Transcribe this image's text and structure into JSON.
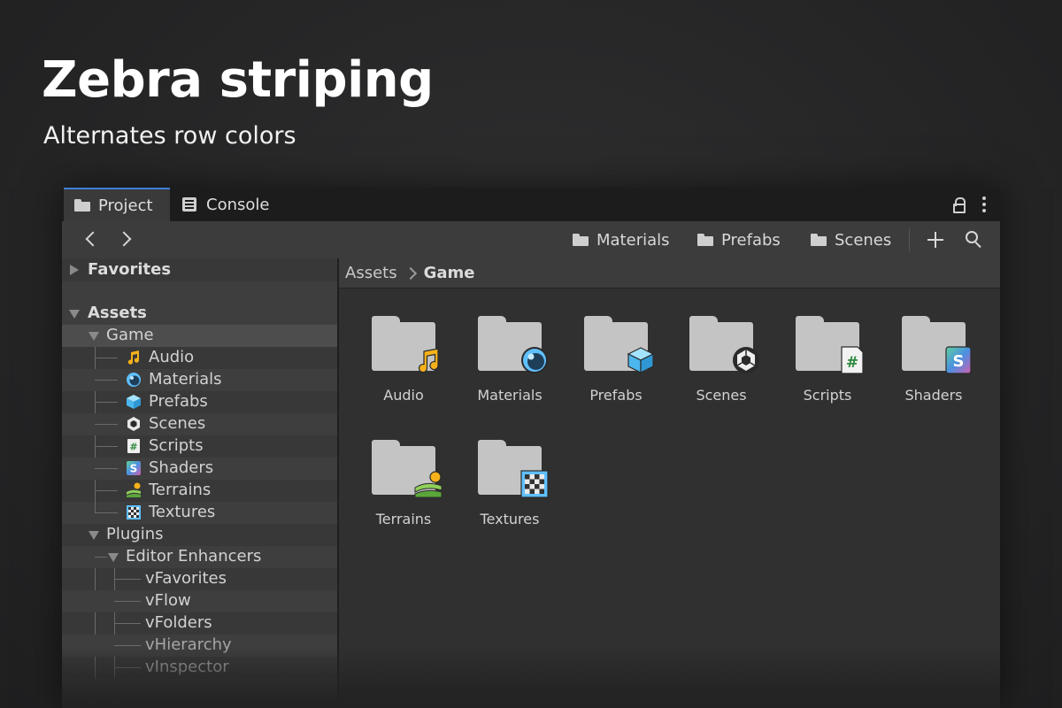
{
  "hero": {
    "title": "Zebra striping",
    "subtitle": "Alternates row colors"
  },
  "tabs": {
    "project": "Project",
    "console": "Console"
  },
  "toolbar": {
    "shortcuts": [
      "Materials",
      "Prefabs",
      "Scenes"
    ]
  },
  "tree": {
    "favorites": "Favorites",
    "assets": "Assets",
    "game": "Game",
    "game_children": [
      "Audio",
      "Materials",
      "Prefabs",
      "Scenes",
      "Scripts",
      "Shaders",
      "Terrains",
      "Textures"
    ],
    "plugins": "Plugins",
    "editor_enhancers": "Editor Enhancers",
    "enhancer_children": [
      "vFavorites",
      "vFlow",
      "vFolders",
      "vHierarchy",
      "vInspector"
    ]
  },
  "breadcrumb": {
    "root": "Assets",
    "current": "Game"
  },
  "grid": {
    "items": [
      "Audio",
      "Materials",
      "Prefabs",
      "Scenes",
      "Scripts",
      "Shaders",
      "Terrains",
      "Textures"
    ]
  },
  "icons": {
    "audio": "music-note-icon",
    "materials": "material-sphere-icon",
    "prefabs": "prefab-cube-icon",
    "scenes": "unity-scene-icon",
    "scripts": "csharp-script-icon",
    "shaders": "shader-icon",
    "terrains": "terrain-icon",
    "textures": "texture-checker-icon"
  },
  "colors": {
    "accent": "#3d7fd6",
    "row_alt": "#3e3e3e",
    "row_selected": "#4d4d4d"
  }
}
